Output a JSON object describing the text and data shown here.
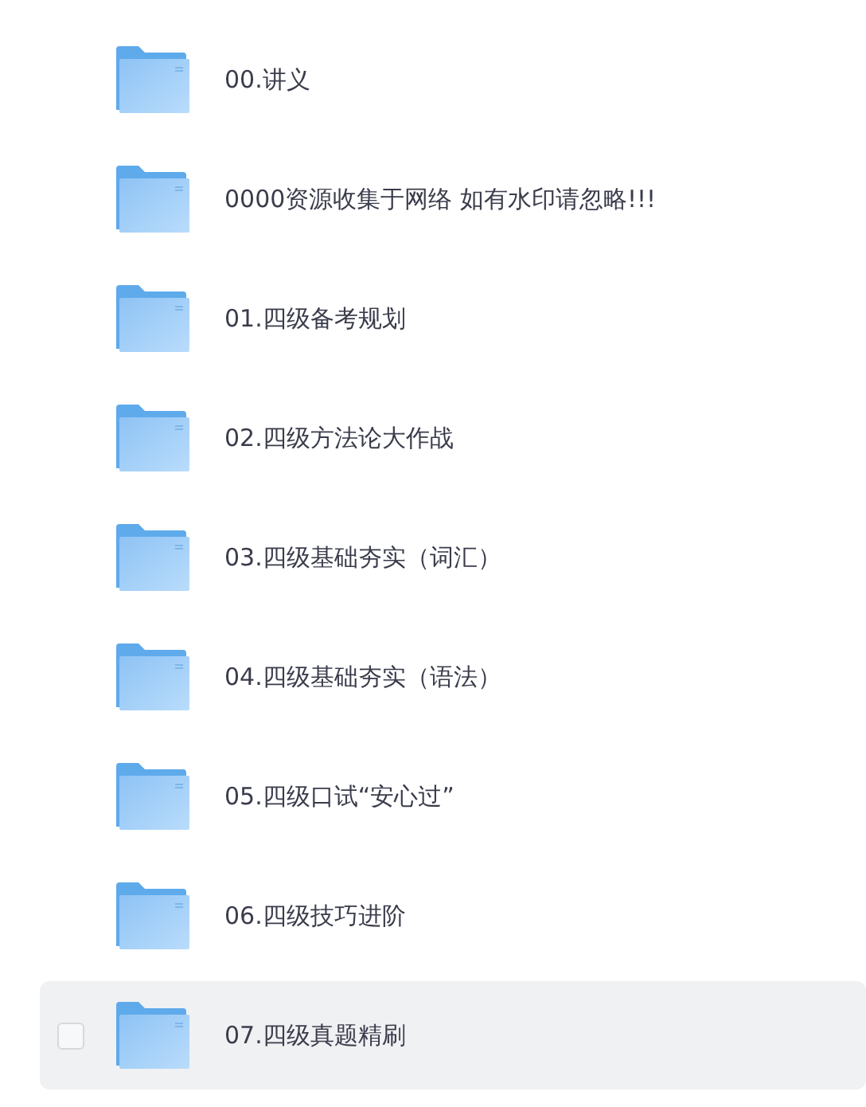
{
  "files": [
    {
      "name": "00.讲义",
      "hovered": false
    },
    {
      "name": "0000资源收集于网络 如有水印请忽略!!!",
      "hovered": false
    },
    {
      "name": "01.四级备考规划",
      "hovered": false
    },
    {
      "name": "02.四级方法论大作战",
      "hovered": false
    },
    {
      "name": "03.四级基础夯实（词汇）",
      "hovered": false
    },
    {
      "name": "04.四级基础夯实（语法）",
      "hovered": false
    },
    {
      "name": "05.四级口试“安心过”",
      "hovered": false
    },
    {
      "name": "06.四级技巧进阶",
      "hovered": false
    },
    {
      "name": "07.四级真题精刷",
      "hovered": true
    }
  ]
}
